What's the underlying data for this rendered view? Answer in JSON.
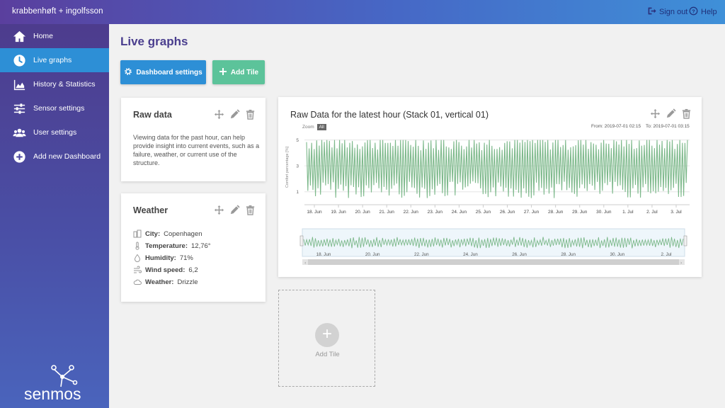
{
  "topbar": {
    "brand": "krabbenhøft + ingolfsson",
    "sign_out": "Sign out",
    "help": "Help"
  },
  "sidebar": {
    "items": [
      {
        "label": "Home",
        "icon": "home-icon"
      },
      {
        "label": "Live graphs",
        "icon": "clock-icon",
        "active": true
      },
      {
        "label": "History & Statistics",
        "icon": "area-chart-icon"
      },
      {
        "label": "Sensor settings",
        "icon": "sliders-icon"
      },
      {
        "label": "User settings",
        "icon": "users-icon"
      },
      {
        "label": "Add new Dashboard",
        "icon": "plus-circle-icon"
      }
    ],
    "logo": "senmos"
  },
  "main": {
    "title": "Live graphs",
    "dashboard_settings": "Dashboard settings",
    "add_tile": "Add Tile"
  },
  "raw_card": {
    "title": "Raw data",
    "text": "Viewing data for the past hour, can help provide insight into current events, such as a failure, weather, or current use of the structure."
  },
  "weather_card": {
    "title": "Weather",
    "rows": [
      {
        "label": "City:",
        "value": "Copenhagen",
        "icon": "city-icon"
      },
      {
        "label": "Temperature:",
        "value": "12,76°",
        "icon": "thermometer-icon"
      },
      {
        "label": "Humidity:",
        "value": "71%",
        "icon": "droplet-icon"
      },
      {
        "label": "Wind speed:",
        "value": "6,2",
        "icon": "wind-icon"
      },
      {
        "label": "Weather:",
        "value": "Drizzle",
        "icon": "cloud-icon"
      }
    ]
  },
  "chart_card": {
    "title": "Raw Data for the latest hour (Stack 01, vertical 01)",
    "zoom_label": "Zoom",
    "zoom_all": "All",
    "from": "From: 2019-07-01 02:15",
    "to": "To: 2019-07-01 03:15"
  },
  "add_tile_placeholder": {
    "label": "Add Tile"
  },
  "colors": {
    "accent": "#2d8fd6",
    "green": "#5cc39a",
    "series": "#7cb88a",
    "title": "#4a3e8e"
  },
  "chart_data": {
    "type": "line",
    "ylabel": "Comfort percentage [%]",
    "y_ticks": [
      "1",
      "3",
      "5"
    ],
    "ylim": [
      0,
      5.8
    ],
    "x_ticks": [
      "18. Jun",
      "19. Jun",
      "20. Jun",
      "21. Jun",
      "22. Jun",
      "23. Jun",
      "24. Jun",
      "25. Jun",
      "26. Jun",
      "27. Jun",
      "28. Jun",
      "29. Jun",
      "30. Jun",
      "1. Jul",
      "2. Jul",
      "3. Jul"
    ],
    "navigator_ticks": [
      "18. Jun",
      "20. Jun",
      "22. Jun",
      "24. Jun",
      "26. Jun",
      "28. Jun",
      "30. Jun",
      "2. Jul"
    ],
    "series": [
      {
        "values_range": [
          0.3,
          5.0
        ],
        "center": 3
      }
    ],
    "grid": true
  }
}
